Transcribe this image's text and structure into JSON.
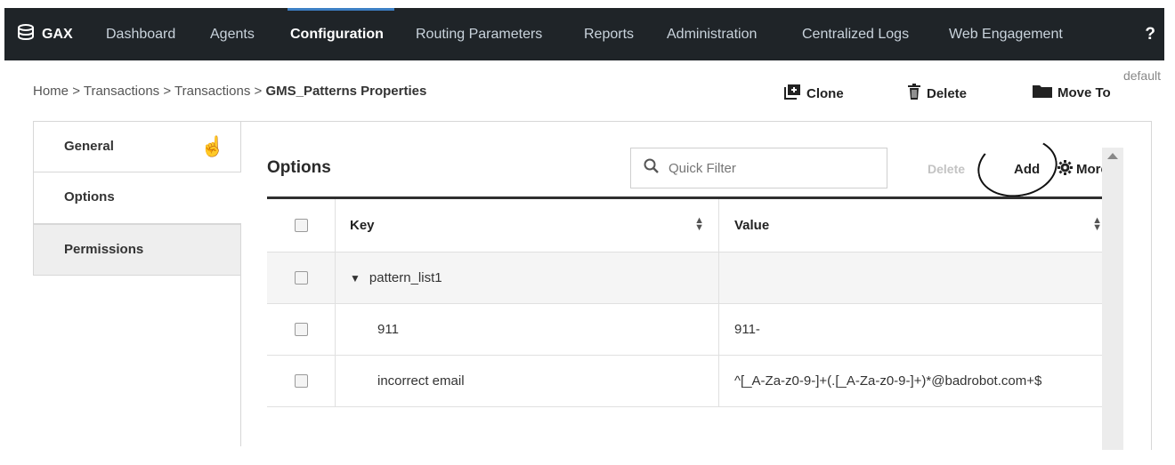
{
  "nav": {
    "brand": "GAX",
    "items": [
      "Dashboard",
      "Agents",
      "Configuration",
      "Routing Parameters",
      "Reports",
      "Administration",
      "Centralized Logs",
      "Web Engagement"
    ],
    "active": "Configuration",
    "help": "?"
  },
  "breadcrumb": {
    "parts": [
      "Home",
      "Transactions",
      "Transactions"
    ],
    "separator": ">",
    "current": "GMS_Patterns Properties"
  },
  "toolbar": {
    "clone_label": "Clone",
    "delete_label": "Delete",
    "move_label": "Move To",
    "tenant": "default"
  },
  "tabs": [
    "General",
    "Options",
    "Permissions"
  ],
  "options": {
    "title": "Options",
    "filter_placeholder": "Quick Filter",
    "delete_label": "Delete",
    "add_label": "Add",
    "more_label": "More",
    "columns": [
      "Key",
      "Value"
    ],
    "rows": [
      {
        "key": "pattern_list1",
        "value": "",
        "group": true
      },
      {
        "key": "911",
        "value": "911-"
      },
      {
        "key": "incorrect email",
        "value": "^[_A-Za-z0-9-]+(.[_A-Za-z0-9-]+)*@badrobot.com+$"
      }
    ]
  },
  "colors": {
    "nav_bg": "#1f2428",
    "accent": "#3d7fc4"
  }
}
